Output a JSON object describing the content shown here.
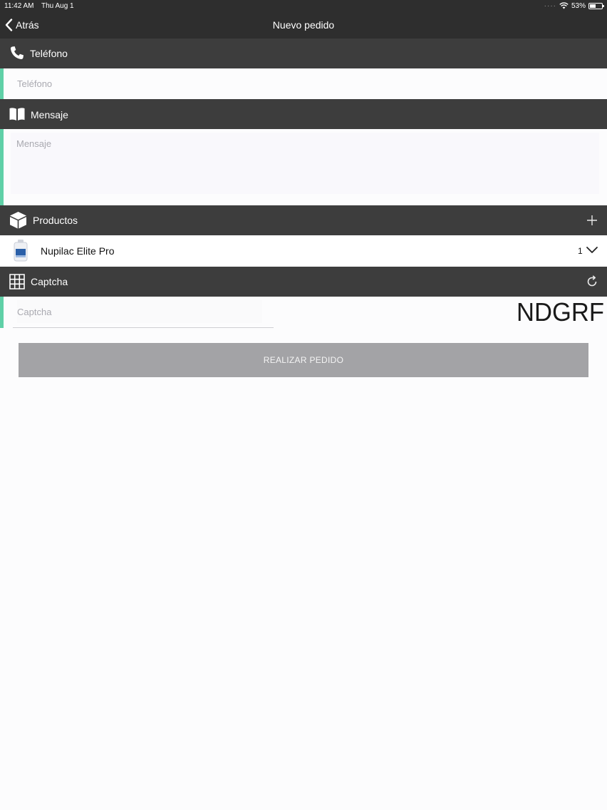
{
  "status_bar": {
    "time": "11:42 AM",
    "date": "Thu Aug 1",
    "battery": "53%",
    "battery_level": 0.53
  },
  "nav": {
    "back_label": "Atrás",
    "title": "Nuevo pedido"
  },
  "phone_section": {
    "title": "Teléfono",
    "icon": "phone-icon",
    "placeholder": "Teléfono"
  },
  "message_section": {
    "title": "Mensaje",
    "icon": "book-icon",
    "placeholder": "Mensaje"
  },
  "products_section": {
    "title": "Productos",
    "icon": "box-icon",
    "action_icon": "plus-icon",
    "items": [
      {
        "name": "Nupilac Elite Pro",
        "quantity": "1"
      }
    ]
  },
  "captcha_section": {
    "title": "Captcha",
    "icon": "grid-icon",
    "action_icon": "refresh-icon",
    "placeholder": "Captcha",
    "code": "NDGRF"
  },
  "submit_label": "REALIZAR PEDIDO",
  "colors": {
    "header_bg": "#3d3d3d",
    "topbar_bg": "#2e2e2e",
    "accent": "#5fd0a7",
    "button_bg": "#a3a3a6"
  }
}
